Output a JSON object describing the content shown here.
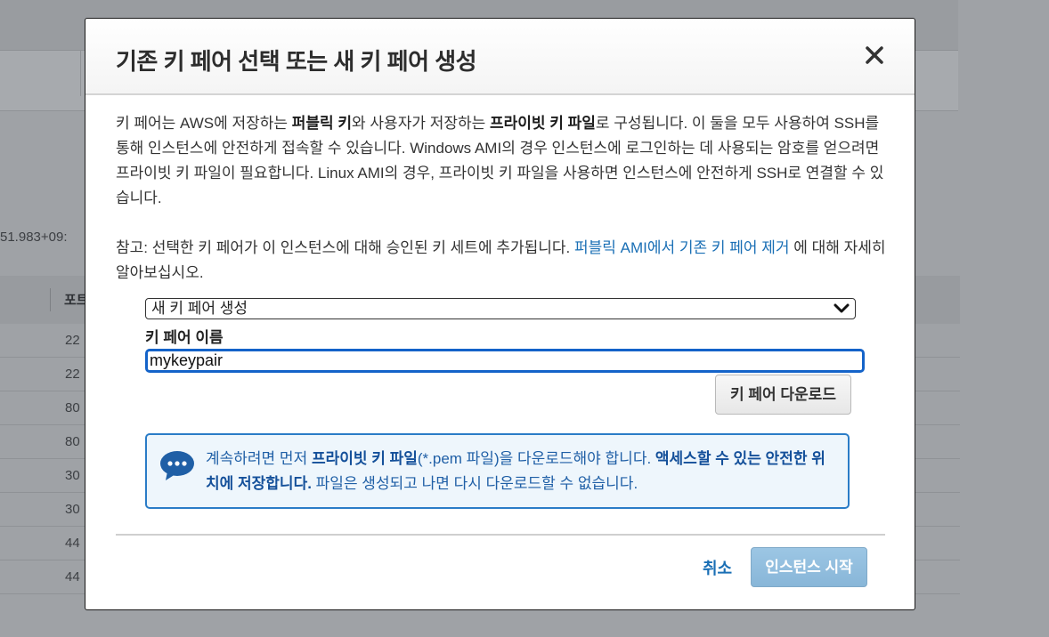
{
  "background": {
    "timestamp": "51.983+09:",
    "column_header": "포트",
    "rows": [
      "22",
      "22",
      "80",
      "80",
      "30",
      "30",
      "44",
      "44"
    ]
  },
  "modal": {
    "title": "기존 키 페어 선택 또는 새 키 페어 생성",
    "close_icon": "close-icon",
    "intro": {
      "part1": "키 페어는 AWS에 저장하는 ",
      "bold1": "퍼블릭 키",
      "part2": "와 사용자가 저장하는 ",
      "bold2": "프라이빗 키 파일",
      "part3": "로 구성됩니다. 이 둘을 모두 사용하여 SSH를 통해 인스턴스에 안전하게 접속할 수 있습니다. Windows AMI의 경우 인스턴스에 로그인하는 데 사용되는 암호를 얻으려면 프라이빗 키 파일이 필요합니다. Linux AMI의 경우, 프라이빗 키 파일을 사용하면 인스턴스에 안전하게 SSH로 연결할 수 있습니다."
    },
    "note": {
      "prefix": "참고: 선택한 키 페어가 이 인스턴스에 대해 승인된 키 세트에 추가됩니다. ",
      "link": "퍼블릭 AMI에서 기존 키 페어 제거",
      "suffix": " 에 대해 자세히 알아보십시오."
    },
    "key_pair_select": {
      "value": "새 키 페어 생성",
      "icon": "chevron-down-icon"
    },
    "key_pair_name": {
      "label": "키 페어 이름",
      "value": "mykeypair"
    },
    "download_button": "키 페어 다운로드",
    "info": {
      "icon": "chat-bubble-icon",
      "part1": "계속하려면 먼저 ",
      "bold1": "프라이빗 키 파일",
      "part2": "(*.pem 파일)을 다운로드해야 합니다. ",
      "bold2": "액세스할 수 있는 안전한 위치에 저장합니다.",
      "part3": " 파일은 생성되고 나면 다시 다운로드할 수 없습니다."
    },
    "cancel": "취소",
    "launch_button": "인스턴스 시작",
    "colors": {
      "accent": "#1463c9",
      "link": "#1a6fb5",
      "info_border": "#2a7cc7",
      "primary_disabled": "#9cc6e4"
    }
  }
}
